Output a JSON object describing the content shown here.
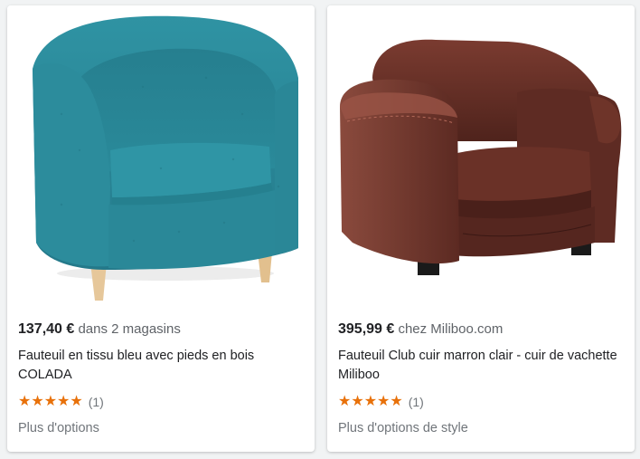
{
  "products": [
    {
      "price": "137,40 €",
      "store_text": "dans 2 magasins",
      "title": "Fauteuil en tissu bleu avec pieds en bois COLADA",
      "stars": "★★★★★",
      "rating_count": "(1)",
      "more_options": "Plus d'options",
      "image_icon": "armchair-teal-fabric-icon",
      "image_color": "#2b8796"
    },
    {
      "price": "395,99 €",
      "store_text": "chez Miliboo.com",
      "title": "Fauteuil Club cuir marron clair - cuir de vachette Miliboo",
      "stars": "★★★★★",
      "rating_count": "(1)",
      "more_options": "Plus d'options de style",
      "image_icon": "armchair-brown-leather-icon",
      "image_color": "#5a2a22"
    }
  ],
  "colors": {
    "star": "#e8710a",
    "price": "#202124",
    "muted": "#70757a"
  }
}
